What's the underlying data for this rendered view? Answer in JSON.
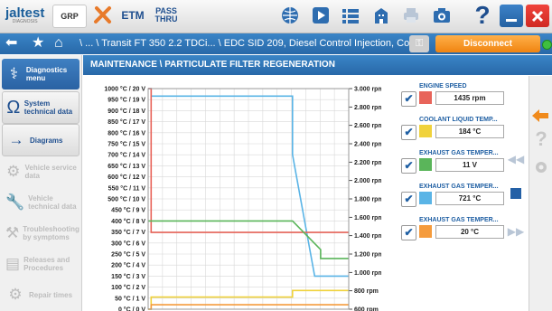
{
  "app": {
    "logo": "jaltest",
    "logo_sub": "DIAGNOSIS",
    "grp_label": "GRP",
    "etm_label": "ETM",
    "pass_line1": "PASS",
    "pass_line2": "THRU",
    "help_label": "?"
  },
  "toolbar": {
    "icons": [
      "wrench-cross-icon",
      "globe-icon",
      "play-icon",
      "list-icon",
      "building-icon",
      "printer-icon",
      "camera-icon"
    ],
    "window_buttons": [
      "minimize-icon",
      "maximize-icon",
      "close-icon"
    ],
    "close_color": "#e4322b",
    "window_color": "#2d6db0"
  },
  "navbar": {
    "breadcrumb": "\\ ... \\ Transit FT 350 2.2 TDCi... \\ EDC SID 209, Diesel Control Injection, Co...",
    "disconnect_label": "Disconnect",
    "status_color": "#3fbf3f"
  },
  "sidebar": {
    "items": [
      {
        "label": "Diagnostics menu",
        "icon": "diagnostics-icon",
        "state": "active"
      },
      {
        "label": "System technical data",
        "icon": "ohm-icon",
        "state": "enabled"
      },
      {
        "label": "Diagrams",
        "icon": "diagram-arrow-icon",
        "state": "enabled"
      },
      {
        "label": "Vehicle service data",
        "icon": "service-icon",
        "state": "disabled"
      },
      {
        "label": "Vehicle technical data",
        "icon": "wrench-icon",
        "state": "disabled"
      },
      {
        "label": "Troubleshooting by symptoms",
        "icon": "troubleshoot-icon",
        "state": "disabled"
      },
      {
        "label": "Releases and Procedures",
        "icon": "procedures-icon",
        "state": "disabled"
      },
      {
        "label": "Repair times",
        "icon": "repair-times-icon",
        "state": "disabled"
      }
    ]
  },
  "main": {
    "title": "MAINTENANCE \\ PARTICULATE FILTER REGENERATION"
  },
  "chart_data": {
    "type": "line",
    "left_axis_ticks": [
      "1000 °C / 20 V",
      "950 °C / 19 V",
      "900 °C / 18 V",
      "850 °C / 17 V",
      "800 °C / 16 V",
      "750 °C / 15 V",
      "700 °C / 14 V",
      "650 °C / 13 V",
      "600 °C / 12 V",
      "550 °C / 11 V",
      "500 °C / 10 V",
      "450 °C / 9 V",
      "400 °C / 8 V",
      "350 °C / 7 V",
      "300 °C / 6 V",
      "250 °C / 5 V",
      "200 °C / 4 V",
      "150 °C / 3 V",
      "100 °C / 2 V",
      "50 °C / 1 V",
      "0 °C / 0 V"
    ],
    "right_axis_ticks": [
      "3.000 rpm",
      "2.800 rpm",
      "2.600 rpm",
      "2.400 rpm",
      "2.200 rpm",
      "2.000 rpm",
      "1.800 rpm",
      "1.600 rpm",
      "1.400 rpm",
      "1.200 rpm",
      "1.000 rpm",
      "800 rpm",
      "600 rpm"
    ],
    "left_range": [
      0,
      1000
    ],
    "right_range": [
      600,
      3000
    ],
    "grid": true,
    "series": [
      {
        "color": "#5ab4e6",
        "axis": "left",
        "x": [
          0,
          0.015,
          0.015,
          0.72,
          0.72,
          0.83,
          0.86,
          1.0
        ],
        "y": [
          1000,
          1000,
          966,
          966,
          700,
          150,
          150,
          150
        ]
      },
      {
        "color": "#e8645a",
        "axis": "right",
        "x": [
          0,
          0.015,
          0.015,
          0.72,
          0.72,
          1.0
        ],
        "y": [
          3000,
          3000,
          1435,
          1435,
          1435,
          1435
        ]
      },
      {
        "color": "#5ab55a",
        "axis": "left",
        "x": [
          0,
          0.015,
          0.015,
          0.72,
          0.72,
          0.86,
          0.86,
          1.0
        ],
        "y": [
          400,
          400,
          400,
          400,
          400,
          270,
          230,
          230
        ]
      },
      {
        "color": "#f0d23c",
        "axis": "left",
        "x": [
          0,
          0.015,
          0.015,
          0.72,
          0.72,
          1.0
        ],
        "y": [
          0,
          0,
          55,
          55,
          85,
          85
        ]
      },
      {
        "color": "#f59b3c",
        "axis": "left",
        "x": [
          0,
          0.015,
          0.015,
          0.72,
          0.72,
          1.0
        ],
        "y": [
          0,
          0,
          20,
          20,
          20,
          20
        ]
      }
    ]
  },
  "params": [
    {
      "name": "ENGINE SPEED",
      "value": "1435 rpm",
      "color": "#e8645a"
    },
    {
      "name": "COOLANT LIQUID TEMP...",
      "value": "184 °C",
      "color": "#f0d23c"
    },
    {
      "name": "EXHAUST GAS TEMPER...",
      "value": "11 V",
      "color": "#5ab55a"
    },
    {
      "name": "EXHAUST GAS TEMPER...",
      "value": "721 °C",
      "color": "#5ab4e6"
    },
    {
      "name": "EXHAUST GAS TEMPER...",
      "value": "20 °C",
      "color": "#f59b3c"
    }
  ]
}
